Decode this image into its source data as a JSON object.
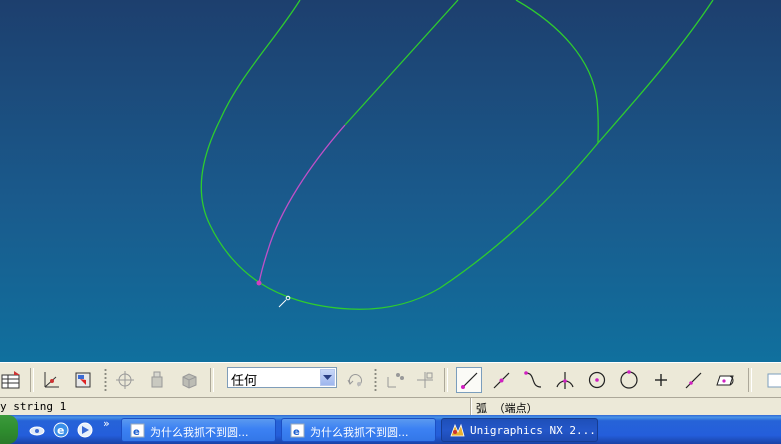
{
  "toolbar": {
    "filter_value": "任何",
    "icons": [
      "layer-table-icon",
      "wcs-icon",
      "view-select-icon",
      "snap-target-icon",
      "solid-layer-icon",
      "shaded-cube-icon",
      "dropdown-arrow-icon",
      "snap-refresh-icon",
      "point-constructor-icon",
      "point-offset-icon",
      "end-point-icon",
      "mid-point-icon",
      "control-point-icon",
      "intersection-icon",
      "arc-center-icon",
      "quadrant-icon",
      "existing-point-icon",
      "point-on-curve-icon",
      "point-on-surface-icon"
    ]
  },
  "statusbar": {
    "left_text": "y string 1",
    "right_text": "弧 （端点）"
  },
  "taskbar": {
    "items": [
      {
        "label": "为什么我抓不到圆..."
      },
      {
        "label": "为什么我抓不到圆..."
      },
      {
        "label": "Unigraphics NX 2..."
      }
    ],
    "chevron": "»"
  },
  "colors": {
    "curve": "#2ecc2e",
    "highlight": "#c050c8",
    "background_top": "#1d3f6e",
    "background_bottom": "#10709e"
  }
}
